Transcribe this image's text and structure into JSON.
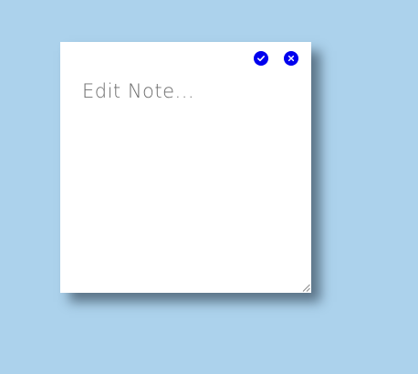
{
  "note": {
    "placeholder": "Edit Note...",
    "value": ""
  },
  "toolbar": {
    "confirm_icon": "check-icon",
    "close_icon": "close-icon"
  },
  "colors": {
    "background": "#acd2ec",
    "note": "#ffffff",
    "button": "#0000ee",
    "text": "#6c6c6c"
  }
}
